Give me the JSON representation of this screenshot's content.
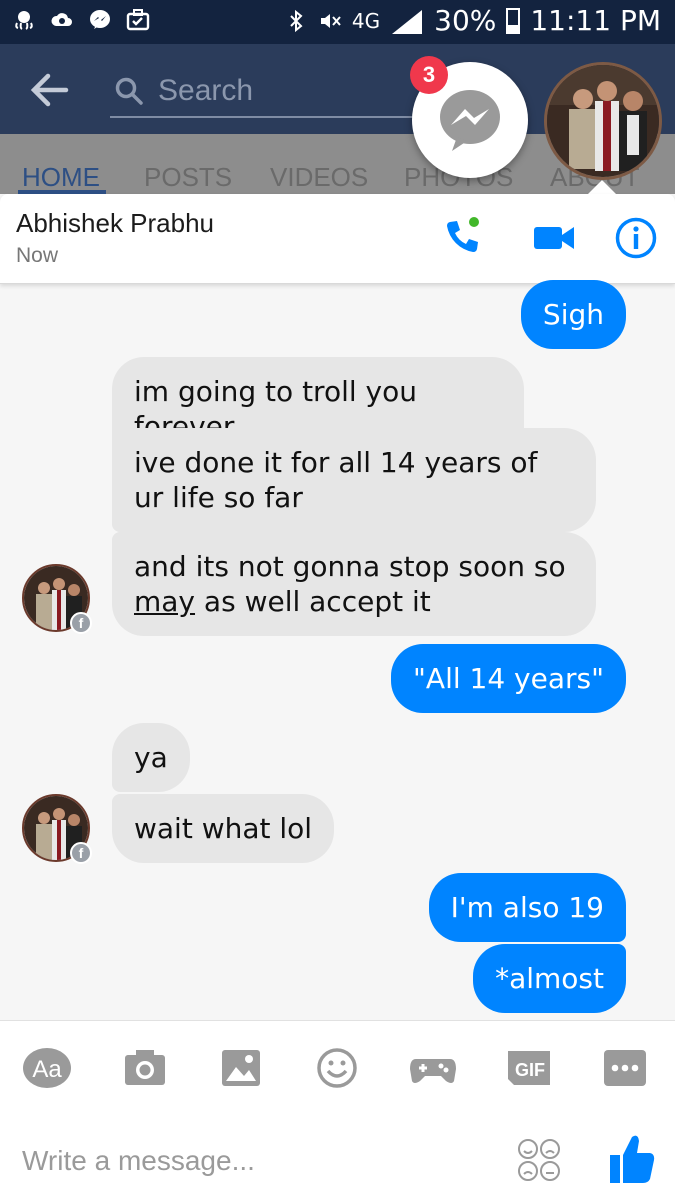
{
  "status_bar": {
    "network": "4G",
    "battery": "30%",
    "time": "11:11 PM"
  },
  "page": {
    "search_placeholder": "Search",
    "tabs": [
      {
        "label": "HOME",
        "active": true
      },
      {
        "label": "POSTS",
        "active": false
      },
      {
        "label": "VIDEOS",
        "active": false
      },
      {
        "label": "PHOTOS",
        "active": false
      },
      {
        "label": "ABOUT",
        "active": false
      }
    ]
  },
  "chat_heads": {
    "unread_count": "3"
  },
  "conversation": {
    "contact_name": "Abhishek Prabhu",
    "status": "Now",
    "header_buttons": [
      "phone-icon",
      "video-camera-icon",
      "info-icon"
    ]
  },
  "messages": [
    {
      "from": "me",
      "text": "Sigh"
    },
    {
      "from": "them",
      "text": "im going to troll you forever"
    },
    {
      "from": "them",
      "text": "ive done it for all 14 years of ur life so far"
    },
    {
      "from": "them",
      "text_parts": [
        "and its not gonna stop soon so",
        "may",
        " as well accept it"
      ]
    },
    {
      "from": "me",
      "text": "\"All 14 years\""
    },
    {
      "from": "them",
      "text": "ya"
    },
    {
      "from": "them",
      "text": "wait what lol"
    },
    {
      "from": "me",
      "text": "I'm also 19"
    },
    {
      "from": "me",
      "text": "*almost"
    }
  ],
  "composer": {
    "placeholder": "Write a message...",
    "tools": [
      {
        "icon": "text-size-icon",
        "label": "Aa"
      },
      {
        "icon": "camera-icon"
      },
      {
        "icon": "image-icon"
      },
      {
        "icon": "smiley-icon"
      },
      {
        "icon": "game-controller-icon"
      },
      {
        "icon": "gif-icon",
        "label": "GIF"
      },
      {
        "icon": "more-icon"
      }
    ]
  },
  "colors": {
    "status_bar": "#13233f",
    "app_bar": "#2b3c5b",
    "messenger_blue": "#0084ff",
    "incoming_bubble": "#e6e6e6",
    "badge_red": "#f0384c"
  }
}
